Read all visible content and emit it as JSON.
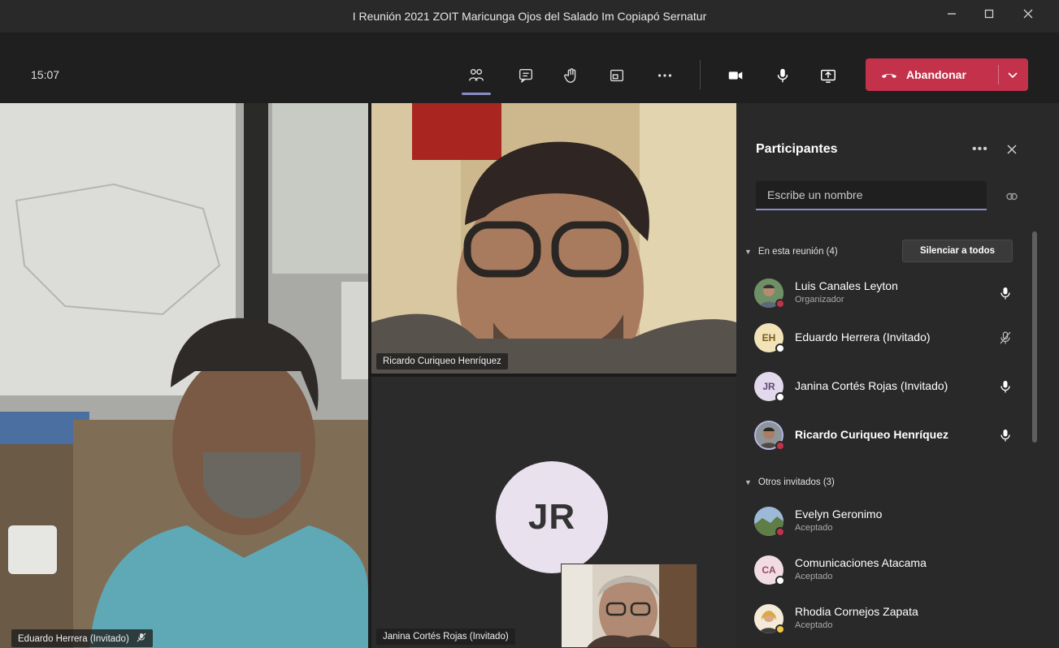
{
  "window": {
    "title": "I Reunión 2021 ZOIT Maricunga Ojos del Salado Im Copiapó Sernatur",
    "minimize_icon": "minimize-icon",
    "maximize_icon": "maximize-icon",
    "close_icon": "close-icon"
  },
  "toolbar": {
    "clock": "15:07",
    "buttons": [
      "participants-icon",
      "chat-icon",
      "raise-hand-icon",
      "rooms-icon",
      "more-icon",
      "camera-icon",
      "microphone-icon",
      "share-screen-icon"
    ],
    "leave_label": "Abandonar",
    "leave_color": "#c4314b"
  },
  "stage": {
    "tiles": [
      {
        "name": "Eduardo Herrera (Invitado)",
        "muted": true
      },
      {
        "name": "Ricardo Curiqueo Henríquez",
        "muted": false
      },
      {
        "name": "Janina Cortés Rojas (Invitado)",
        "initials": "JR",
        "muted": false
      }
    ]
  },
  "panel": {
    "title": "Participantes",
    "more_label": "•••",
    "search_placeholder": "Escribe un nombre",
    "in_meeting_label": "En esta reunión (4)",
    "mute_all_label": "Silenciar a todos",
    "others_label": "Otros invitados (3)",
    "in_meeting": [
      {
        "name": "Luis Canales Leyton",
        "role": "Organizador",
        "avatar": "photo",
        "status": "#c4314b",
        "mic": "on"
      },
      {
        "name": "Eduardo Herrera (Invitado)",
        "initials": "EH",
        "avatar_color": "#f3e3b8",
        "status": "#ffffff",
        "mic": "muted"
      },
      {
        "name": "Janina Cortés Rojas (Invitado)",
        "initials": "JR",
        "avatar_color": "#e3d9ec",
        "status": "#ffffff",
        "mic": "on"
      },
      {
        "name": "Ricardo Curiqueo Henríquez",
        "avatar": "photo",
        "status": "#c4314b",
        "mic": "on",
        "active": true
      }
    ],
    "others": [
      {
        "name": "Evelyn Geronimo",
        "role": "Aceptado",
        "avatar": "photo",
        "status": "#c4314b"
      },
      {
        "name": "Comunicaciones Atacama",
        "role": "Aceptado",
        "initials": "CA",
        "avatar_color": "#f1dce4",
        "status": "#ffffff"
      },
      {
        "name": "Rhodia Cornejos Zapata",
        "role": "Aceptado",
        "avatar": "photo",
        "status": "#f2c744"
      }
    ]
  }
}
